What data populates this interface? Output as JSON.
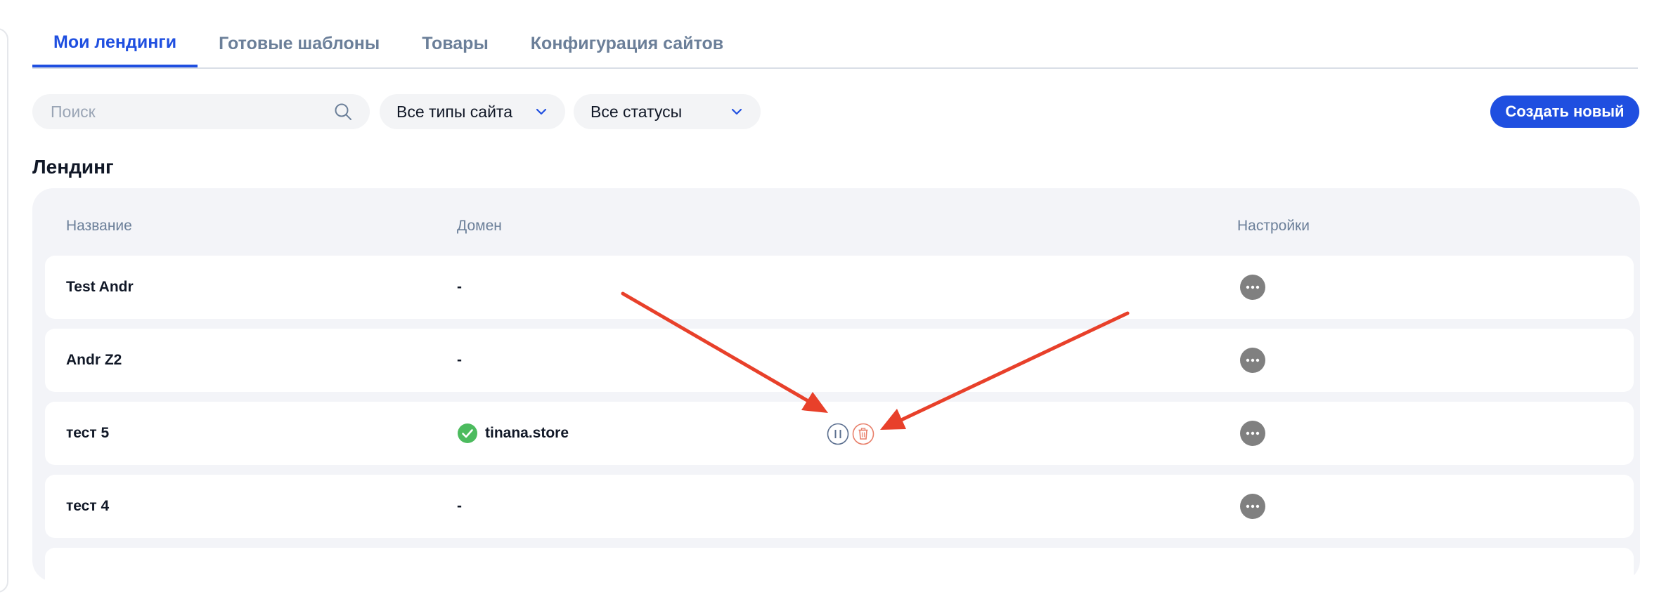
{
  "tabs": [
    {
      "label": "Мои лендинги",
      "active": true
    },
    {
      "label": "Готовые шаблоны",
      "active": false
    },
    {
      "label": "Товары",
      "active": false
    },
    {
      "label": "Конфигурация сайтов",
      "active": false
    }
  ],
  "filters": {
    "search_placeholder": "Поиск",
    "site_type": "Все типы сайта",
    "status": "Все статусы"
  },
  "create_label": "Создать новый",
  "section_title": "Лендинг",
  "table": {
    "headers": {
      "name": "Название",
      "domain": "Домен",
      "settings": "Настройки"
    },
    "rows": [
      {
        "name": "Test Andr",
        "domain": "-"
      },
      {
        "name": "Andr Z2",
        "domain": "-"
      },
      {
        "name": "тест 5",
        "domain": "tinana.store",
        "domain_status": "active",
        "actions": [
          "pause-icon",
          "trash-icon"
        ]
      },
      {
        "name": "тест 4",
        "domain": "-"
      }
    ]
  },
  "colors": {
    "accent": "#1f4fe0",
    "annotation_arrow": "#e8402a",
    "domain_ok": "#4cbb5e",
    "delete": "#e8806b",
    "pause": "#5b6f8f"
  }
}
